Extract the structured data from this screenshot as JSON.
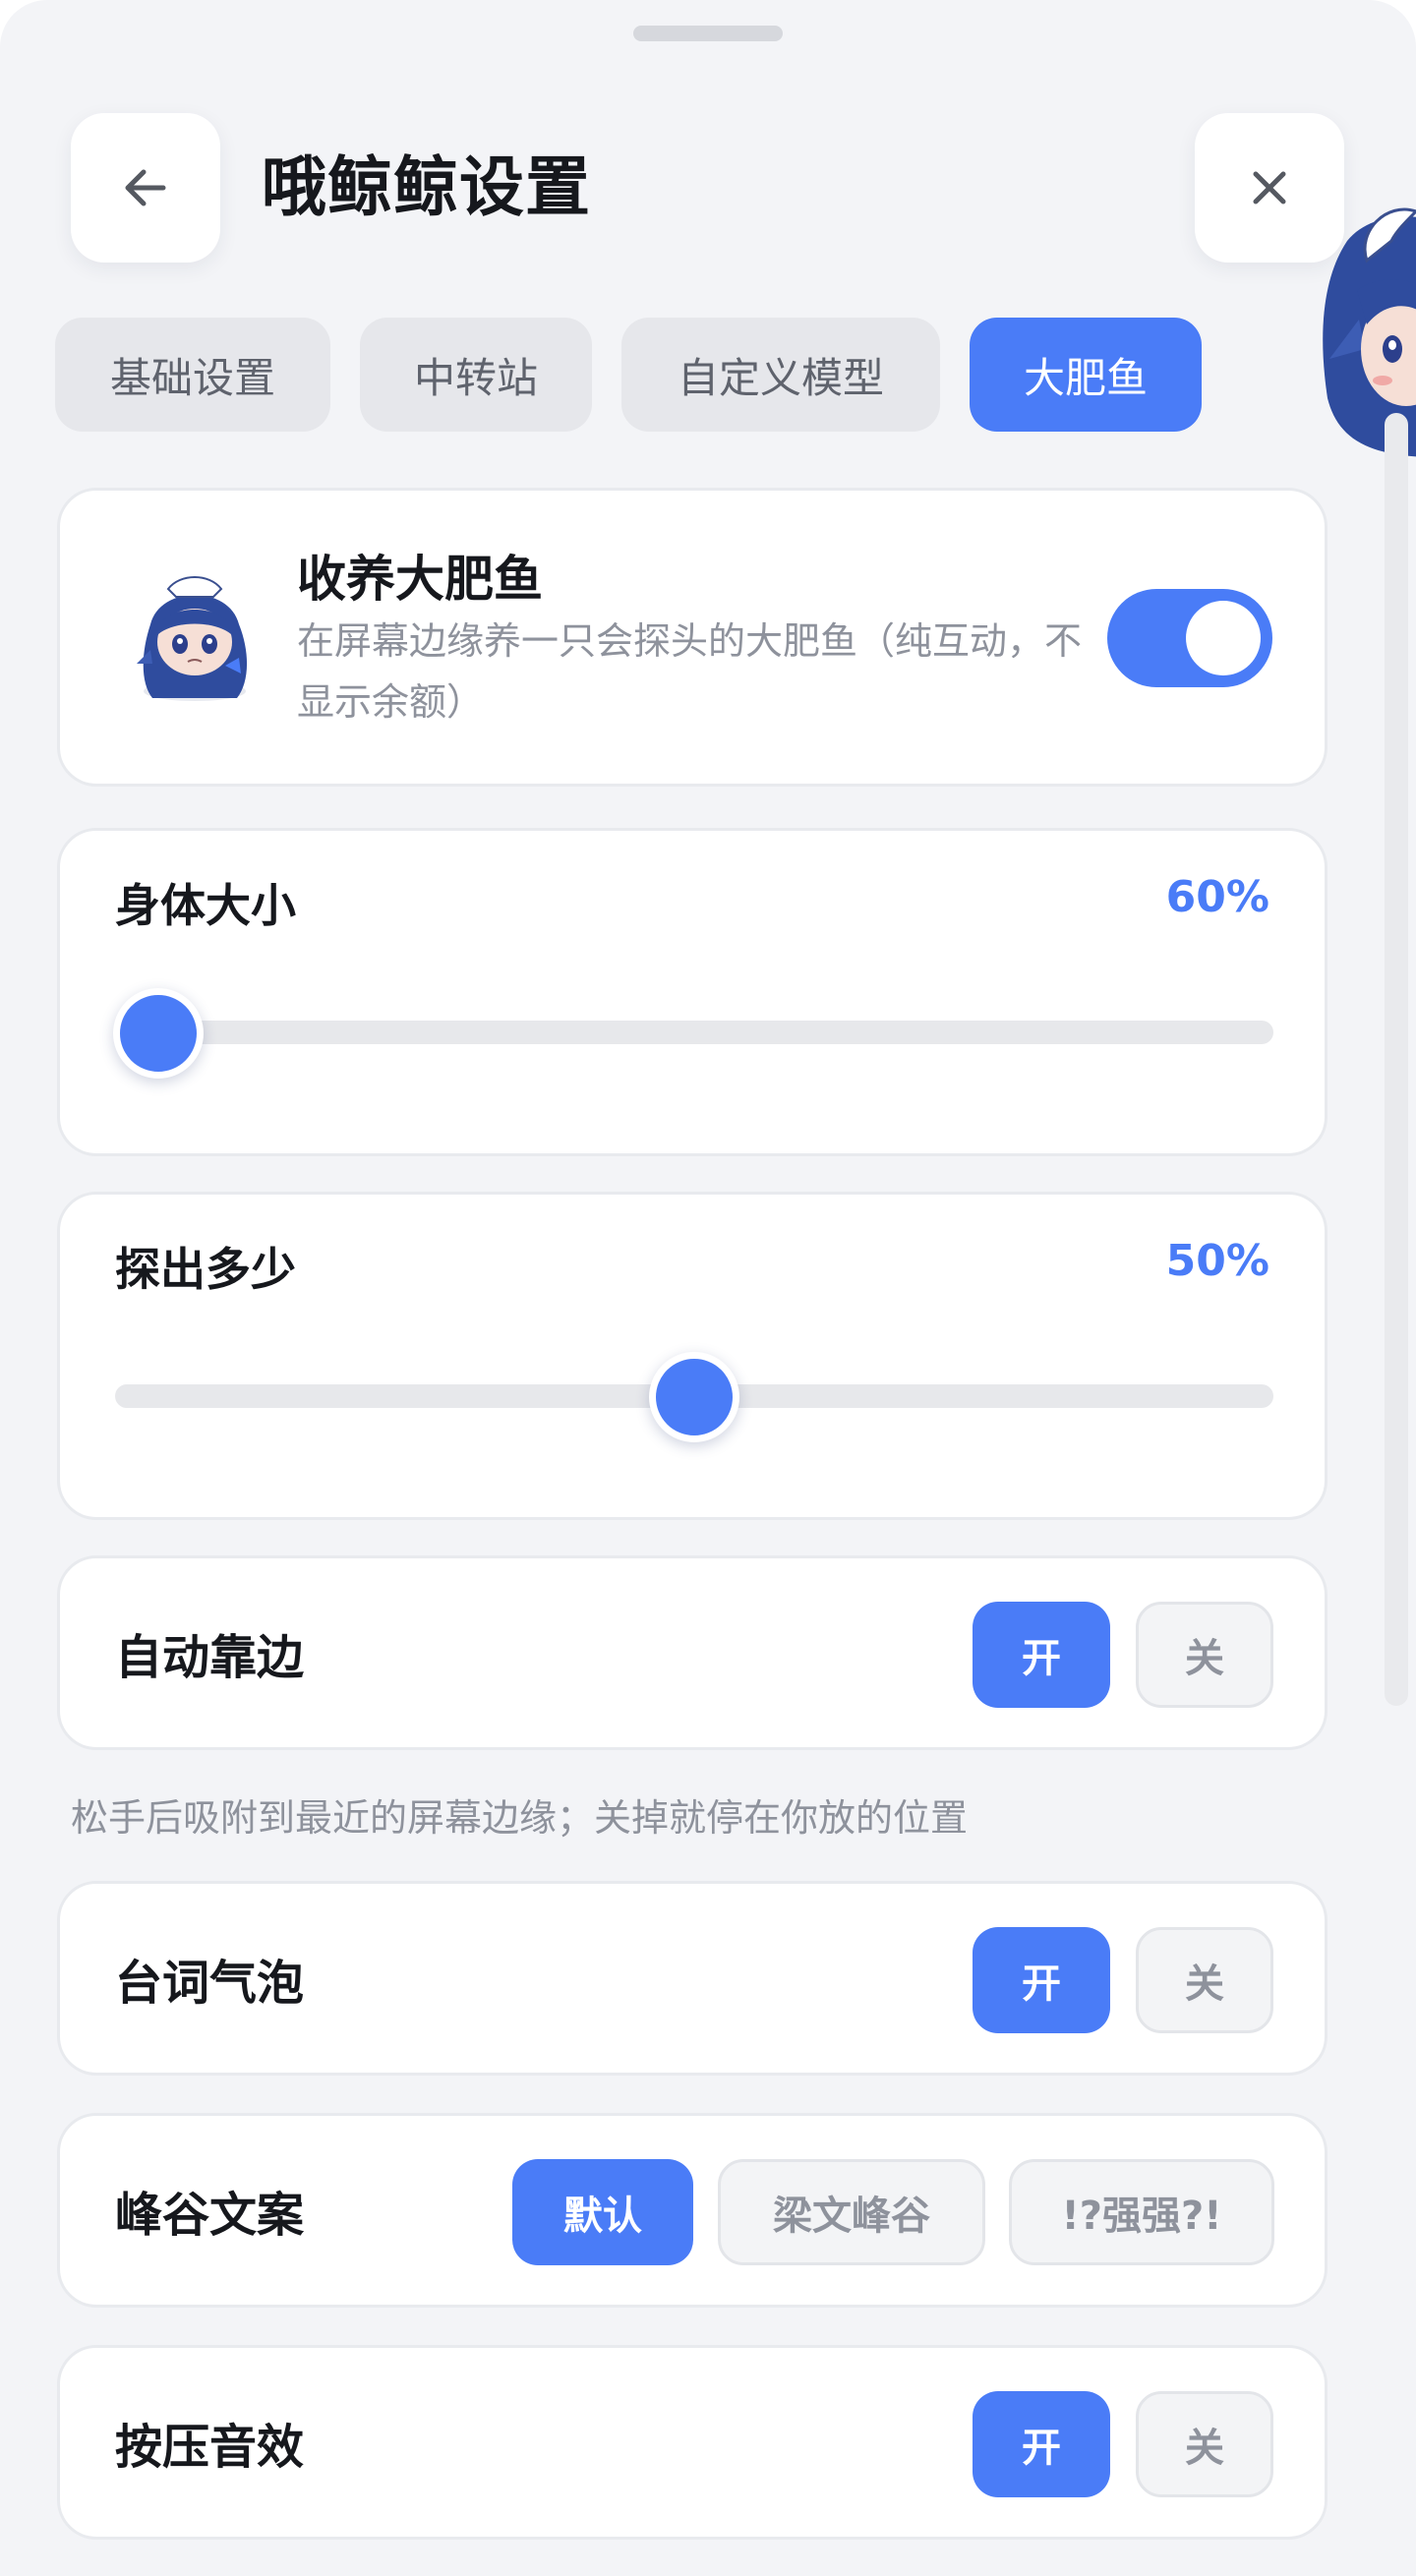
{
  "header": {
    "title": "哦鲸鲸设置"
  },
  "tabs": [
    {
      "label": "基础设置",
      "active": false
    },
    {
      "label": "中转站",
      "active": false
    },
    {
      "label": "自定义模型",
      "active": false
    },
    {
      "label": "大肥鱼",
      "active": true
    }
  ],
  "adopt": {
    "title": "收养大肥鱼",
    "description": "在屏幕边缘养一只会探头的大肥鱼（纯互动，不显示余额）",
    "enabled": true
  },
  "body_size": {
    "label": "身体大小",
    "value_text": "60%",
    "level": 0
  },
  "peek_amount": {
    "label": "探出多少",
    "value_text": "50%",
    "level": 0.5
  },
  "auto_edge": {
    "label": "自动靠边",
    "on_label": "开",
    "off_label": "关",
    "selected": "开"
  },
  "auto_edge_hint": "松手后吸附到最近的屏幕边缘；关掉就停在你放的位置",
  "bubble": {
    "label": "台词气泡",
    "on_label": "开",
    "off_label": "关",
    "selected": "开"
  },
  "copywriting": {
    "label": "峰谷文案",
    "options": [
      "默认",
      "梁文峰谷",
      "!?强强?!"
    ],
    "selected": "默认"
  },
  "press_sound": {
    "label": "按压音效",
    "on_label": "开",
    "off_label": "关",
    "selected": "开"
  },
  "colors": {
    "accent": "#4a7cf7",
    "background": "#f3f4f7",
    "card": "#ffffff",
    "muted_text": "#8e929c"
  },
  "icons": {
    "back": "arrow-left-icon",
    "close": "close-icon"
  }
}
